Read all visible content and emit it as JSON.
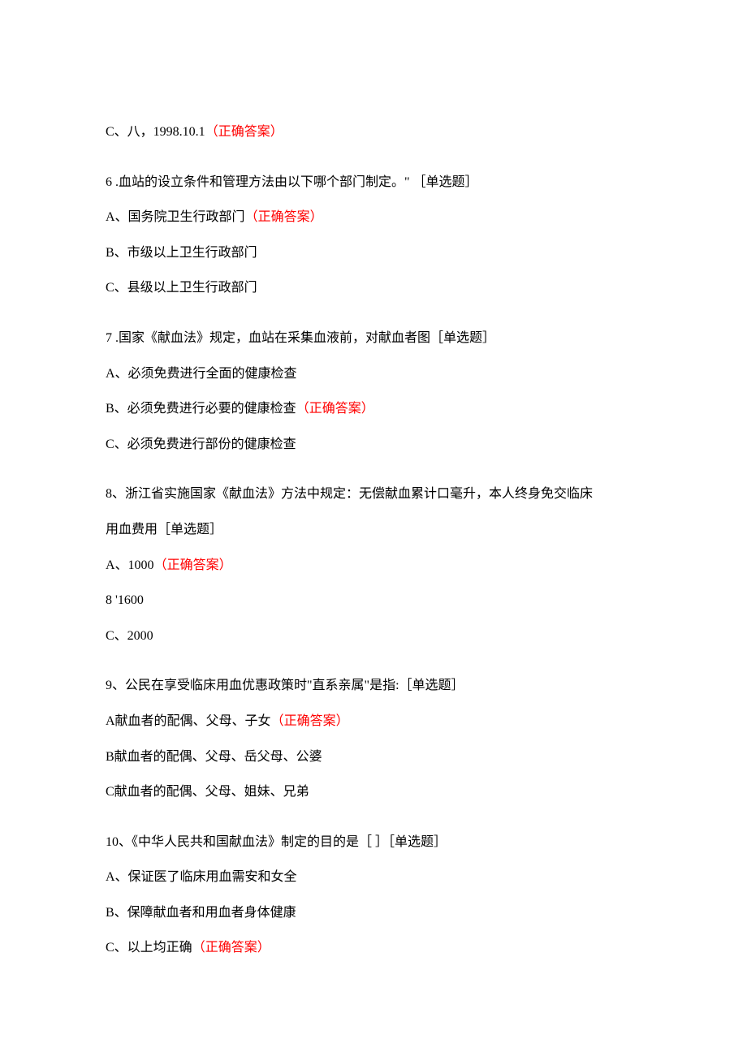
{
  "q5_option_c": {
    "prefix": "C、八，1998.10.1",
    "answer": "（正确答案）"
  },
  "q6": {
    "question": "6  .血站的设立条件和管理方法由以下哪个部门制定。\" ［单选题］",
    "opt_a_prefix": "A、国务院卫生行政部门",
    "opt_a_answer": "（正确答案）",
    "opt_b": "B、市级以上卫生行政部门",
    "opt_c": "C、县级以上卫生行政部门"
  },
  "q7": {
    "question": "7  .国家《献血法》规定，血站在采集血液前，对献血者图［单选题］",
    "opt_a": "A、必须免费进行全面的健康检查",
    "opt_b_prefix": "B、必须免费进行必要的健康检查",
    "opt_b_answer": "（正确答案）",
    "opt_c": "C、必须免费进行部份的健康检查"
  },
  "q8": {
    "question_line1": "8、浙江省实施国家《献血法》方法中规定：无偿献血累计口毫升，本人终身免交临床",
    "question_line2": "用血费用［单选题］",
    "opt_a_prefix": "A、1000",
    "opt_a_answer": "（正确答案）",
    "opt_b": "8   '1600",
    "opt_c": "C、2000"
  },
  "q9": {
    "question": "9、公民在享受临床用血优惠政策时\"直系亲属\"是指:［单选题］",
    "opt_a_prefix": "A献血者的配偶、父母、子女",
    "opt_a_answer": "（正确答案）",
    "opt_b": "B献血者的配偶、父母、岳父母、公婆",
    "opt_c": "C献血者的配偶、父母、姐妹、兄弟"
  },
  "q10": {
    "question": "10、《中华人民共和国献血法》制定的目的是［ ］［单选题］",
    "opt_a": "A、保证医了临床用血需安和女全",
    "opt_b": "B、保障献血者和用血者身体健康",
    "opt_c_prefix": "C、以上均正确",
    "opt_c_answer": "（正确答案）"
  }
}
